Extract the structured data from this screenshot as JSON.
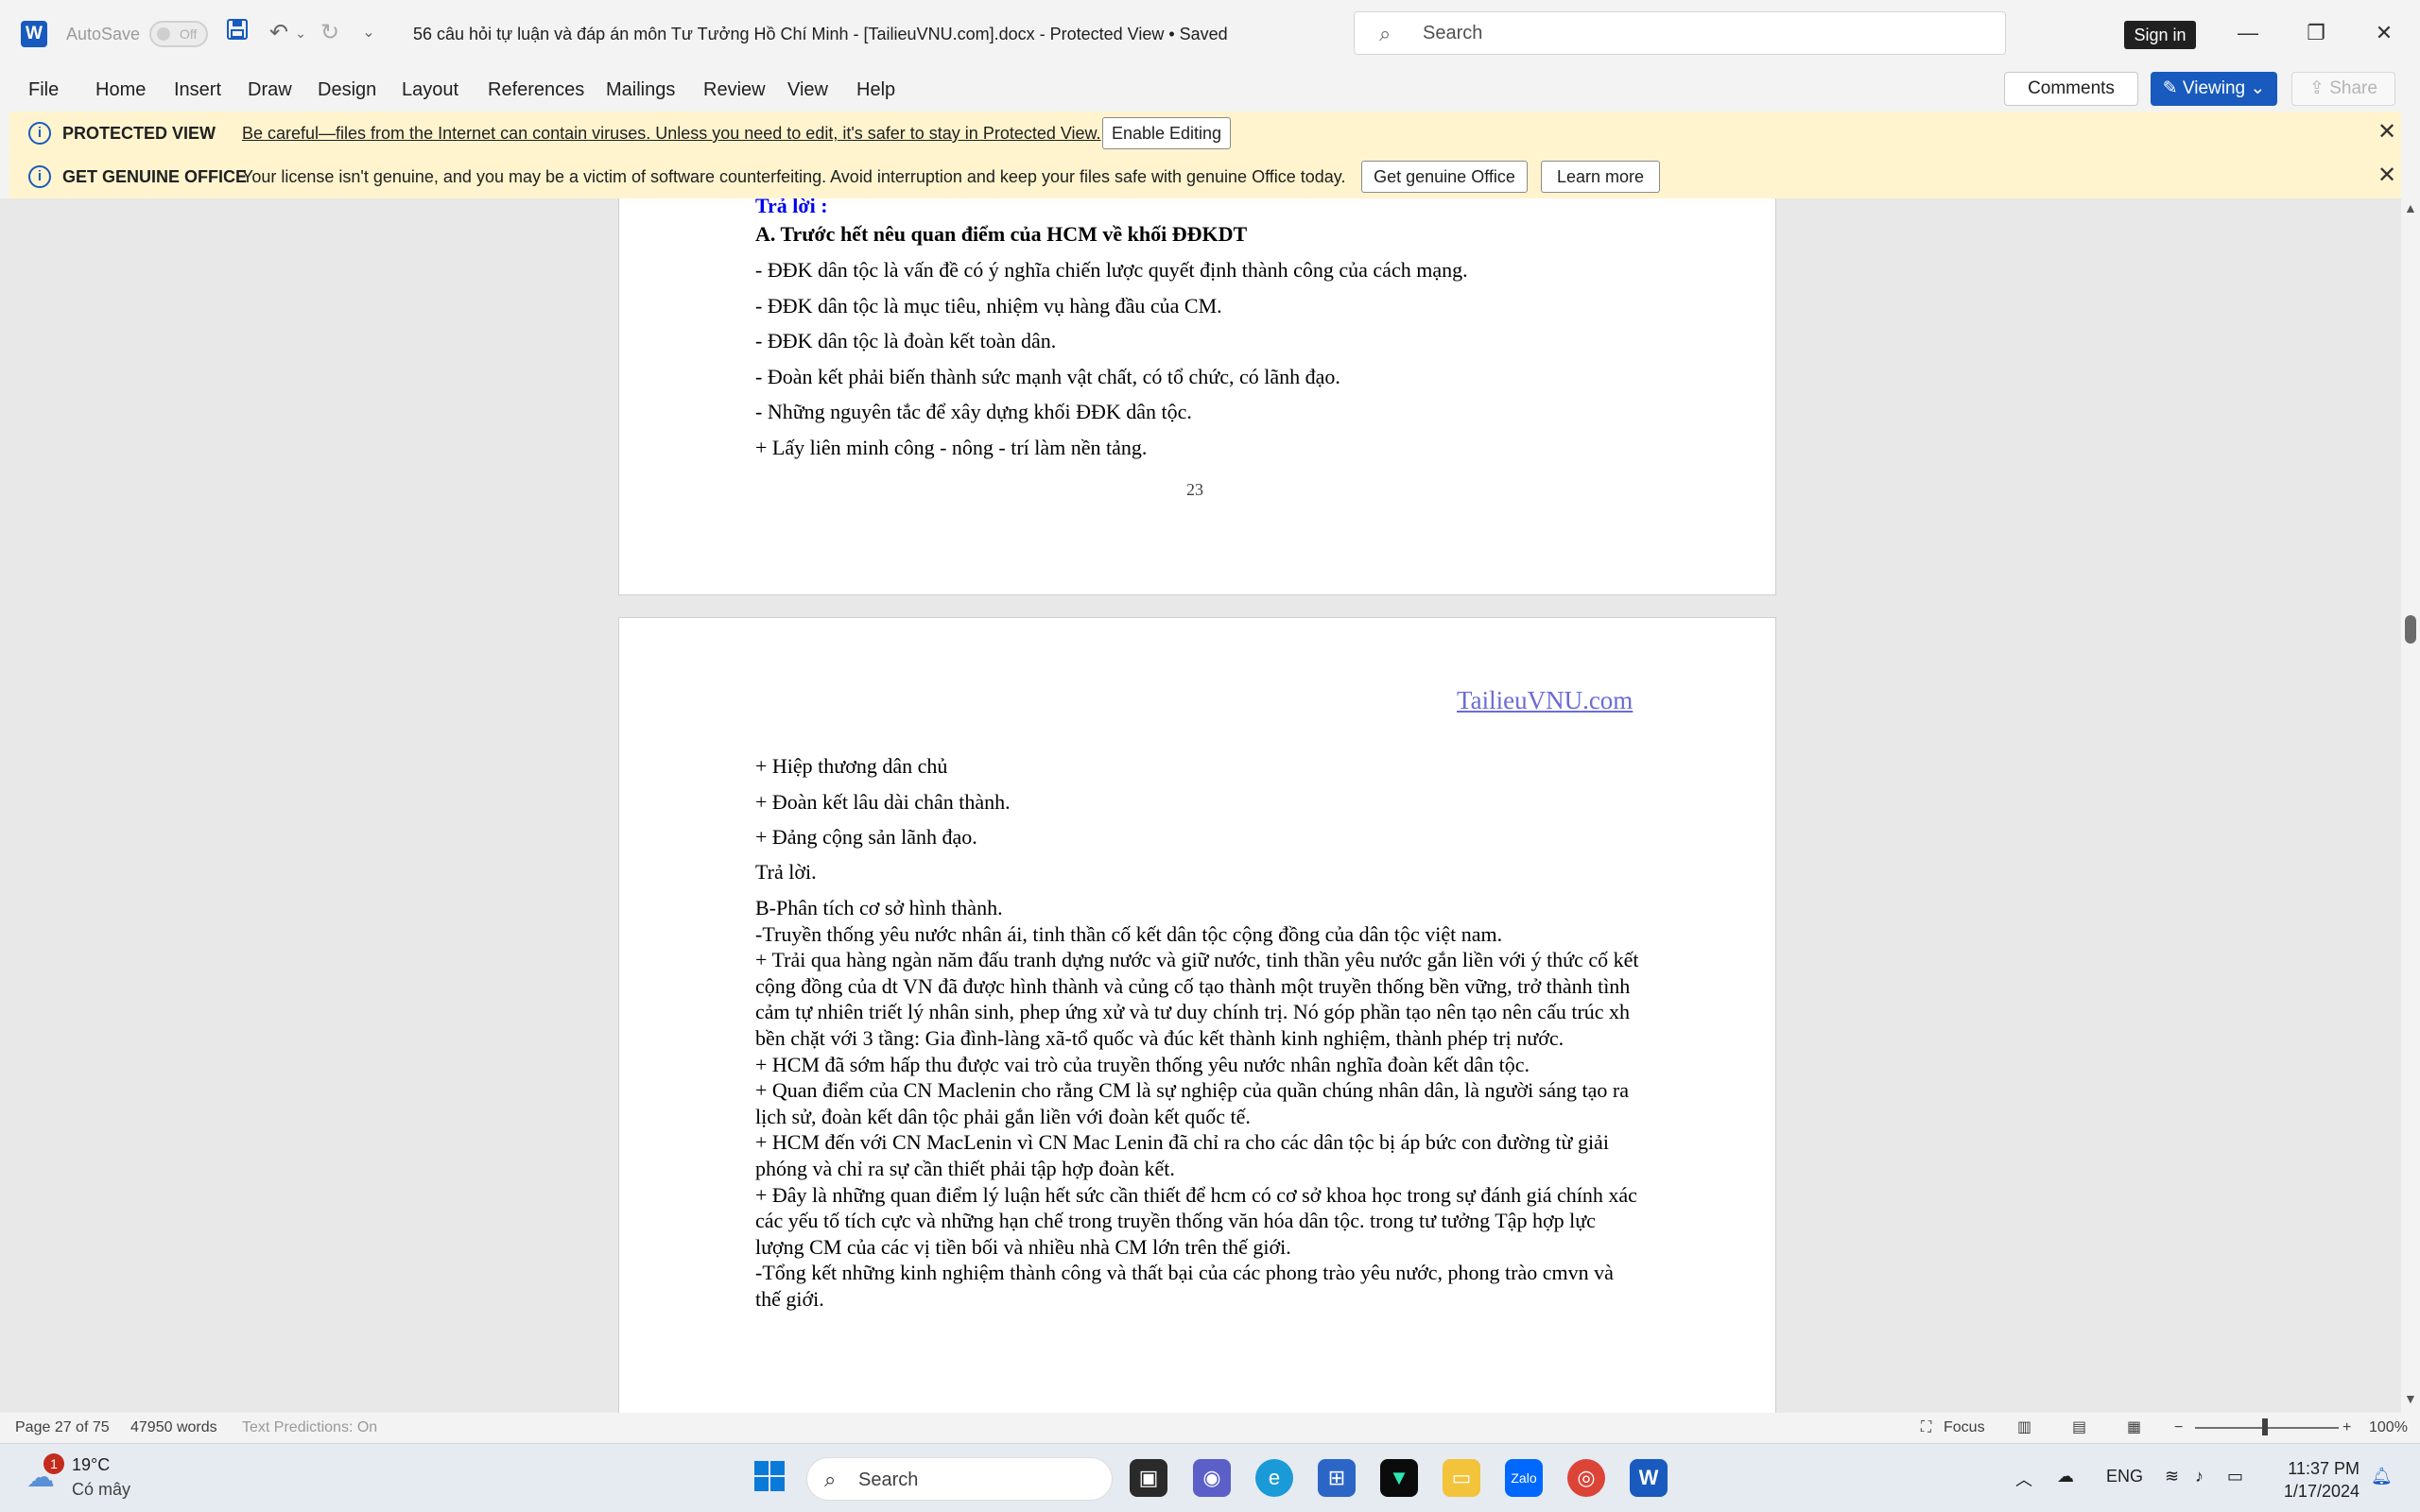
{
  "titlebar": {
    "app_icon": "word-logo-icon",
    "autosave_label": "AutoSave",
    "autosave_state": "Off",
    "doc_title": "56 câu hỏi tự luận và đáp án môn Tư Tưởng Hồ Chí Minh - [TailieuVNU.com].docx  -  Protected View • Saved ",
    "search_placeholder": "Search",
    "signin_label": "Sign in"
  },
  "menu": {
    "items": [
      "File",
      "Home",
      "Insert",
      "Draw",
      "Design",
      "Layout",
      "References",
      "Mailings",
      "Review",
      "View",
      "Help"
    ],
    "comments_label": "Comments",
    "viewing_label": "Viewing",
    "share_label": "Share"
  },
  "banners": {
    "protected_title": "PROTECTED VIEW",
    "protected_msg": "Be careful—files from the Internet can contain viruses. Unless you need to edit, it's safer to stay in Protected View.",
    "enable_editing": "Enable Editing",
    "genuine_title": "GET GENUINE OFFICE",
    "genuine_msg": "Your license isn't genuine, and you may be a victim of software counterfeiting. Avoid interruption and keep your files safe with genuine Office today.",
    "get_genuine": "Get genuine Office",
    "learn_more": "Learn more"
  },
  "page1": {
    "partial_heading": "Trả lời :",
    "heading": "A. Trước hết nêu quan điểm của HCM về khối ĐĐKDT",
    "lines": [
      "- ĐĐK dân tộc là vấn đề có ý nghĩa chiến lược quyết định thành công của cách mạng.",
      "- ĐĐK dân tộc là mục tiêu, nhiệm vụ hàng đầu của CM.",
      "- ĐĐK dân tộc là đoàn kết toàn dân.",
      "- Đoàn kết phải biến thành sức mạnh vật chất, có tổ  chức, có lãnh đạo.",
      "- Những nguyên tắc để xây dựng khối ĐĐK dân tộc.",
      "+ Lấy liên minh công - nông - trí làm nền tảng."
    ],
    "page_number": "23"
  },
  "page2": {
    "header_link": "TailieuVNU.com",
    "lines": [
      "+ Hiệp thương dân chủ",
      "+ Đoàn kết lâu dài chân thành.",
      "+ Đảng cộng sản lãnh đạo.",
      "Trả lời."
    ],
    "body": "B-Phân tích cơ sở hình thành.\n-Truyền thống yêu nước nhân ái, tinh thần cố kết dân tộc cộng đồng của dân tộc việt nam.\n+ Trải qua hàng ngàn năm đấu tranh dựng nước và giữ nước, tinh thần yêu nước gắn liền với ý thức cố kết cộng đồng của dt VN đã được hình thành và củng cố tạo thành một truyền thống bền vững, trở thành tình cảm tự nhiên triết lý nhân sinh, phep ứng xử và tư duy chính trị. Nó góp phần tạo nên tạo nên cấu trúc xh bền chặt với 3 tầng: Gia đình-làng xã-tổ quốc và đúc kết thành kinh nghiệm, thành phép trị nước.\n+ HCM đã sớm hấp thu được vai trò của truyền thống yêu nước nhân nghĩa đoàn kết dân tộc.\n+ Quan điểm của CN Maclenin cho rằng CM là sự nghiệp của quần chúng nhân dân, là người sáng tạo ra lịch sử, đoàn kết dân tộc phải gắn liền với đoàn kết quốc tế.\n+ HCM đến với CN MacLenin vì CN Mac Lenin đã chỉ ra cho các dân tộc bị áp bức con đường từ giải phóng và chỉ ra sự cần thiết phải tập hợp đoàn kết.\n+ Đây là những quan điểm lý luận hết sức cần thiết để hcm có cơ sở khoa học trong sự đánh giá chính xác các yếu tố tích cực và những hạn chế trong truyền thống văn hóa dân tộc. trong tư tưởng Tập hợp lực lượng CM của các vị tiền bối và nhiều nhà CM lớn trên thế giới.\n-Tổng kết những kinh nghiệm thành công và thất bại của các phong trào yêu nước, phong trào cmvn và thế giới."
  },
  "status": {
    "page": "Page 27 of 75",
    "words": "47950 words",
    "predictions": "Text Predictions: On",
    "focus": "Focus",
    "zoom": "100%"
  },
  "taskbar": {
    "temperature": "19°C",
    "weather_desc": "Có mây",
    "weather_badge": "1",
    "search_label": "Search",
    "language": "ENG",
    "time": "11:37 PM",
    "date": "1/17/2024"
  },
  "colors": {
    "accent": "#185abd",
    "banner": "#fff4ce"
  }
}
